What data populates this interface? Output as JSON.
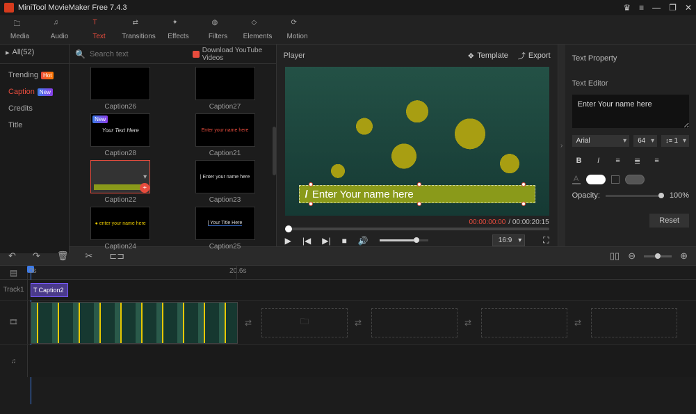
{
  "titlebar": {
    "title": "MiniTool MovieMaker Free 7.4.3"
  },
  "toolbar": {
    "items": [
      {
        "label": "Media"
      },
      {
        "label": "Audio"
      },
      {
        "label": "Text"
      },
      {
        "label": "Transitions"
      },
      {
        "label": "Effects"
      },
      {
        "label": "Filters"
      },
      {
        "label": "Elements"
      },
      {
        "label": "Motion"
      }
    ]
  },
  "categories": {
    "header": "All(52)",
    "search_placeholder": "Search text",
    "yt_label": "Download YouTube Videos",
    "items": [
      {
        "label": "Trending",
        "badge": "Hot",
        "badge_class": "badge-hot"
      },
      {
        "label": "Caption",
        "badge": "New",
        "badge_class": "badge-new",
        "active": true
      },
      {
        "label": "Credits"
      },
      {
        "label": "Title"
      }
    ]
  },
  "thumbs": [
    {
      "label": "Caption26"
    },
    {
      "label": "Caption27"
    },
    {
      "label": "Caption28"
    },
    {
      "label": "Caption21"
    },
    {
      "label": "Caption22",
      "selected": true
    },
    {
      "label": "Caption23"
    },
    {
      "label": "Caption24"
    },
    {
      "label": "Caption25"
    }
  ],
  "player": {
    "title": "Player",
    "template_label": "Template",
    "export_label": "Export",
    "caption_text": "Enter Your name here",
    "time_current": "00:00:00:00",
    "time_total": "00:00:20:15",
    "aspect": "16:9"
  },
  "text_prop": {
    "title": "Text Property",
    "editor_label": "Text Editor",
    "name_value": "Enter Your name here",
    "font": "Arial",
    "size": "64",
    "line": "1",
    "opacity_label": "Opacity:",
    "opacity_value": "100%",
    "reset_label": "Reset"
  },
  "timeline": {
    "time_mark": "20.6s",
    "zero": "0s",
    "track1_label": "Track1",
    "caption_clip": "Caption2"
  }
}
